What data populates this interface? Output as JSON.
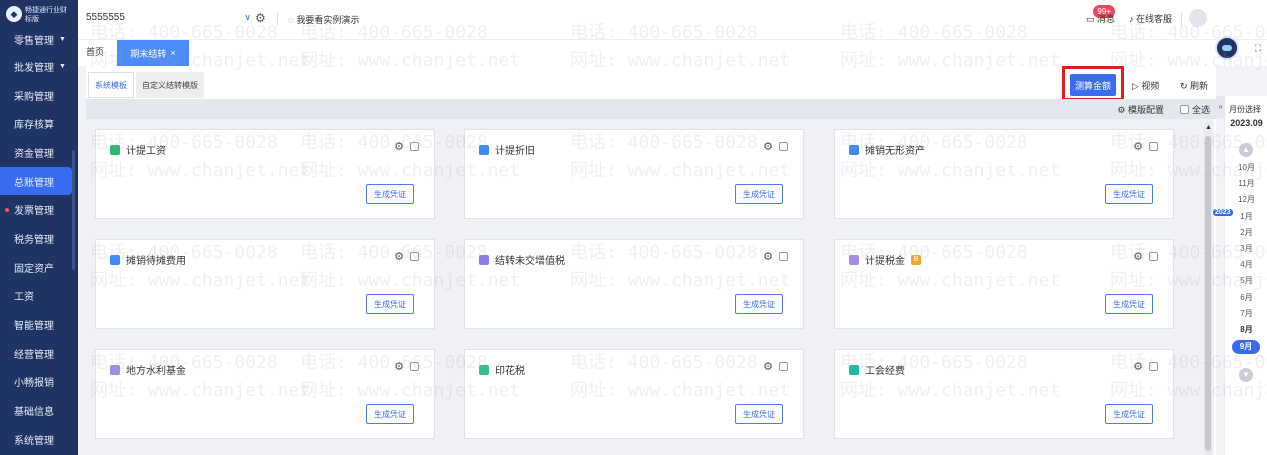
{
  "sidebar": {
    "brand": "畅捷通行业财\n标版",
    "items": [
      {
        "label": "零售管理"
      },
      {
        "label": "批发管理"
      },
      {
        "label": "采购管理"
      },
      {
        "label": "库存核算"
      },
      {
        "label": "资金管理"
      },
      {
        "label": "总账管理"
      },
      {
        "label": "发票管理"
      },
      {
        "label": "税务管理"
      },
      {
        "label": "固定资产"
      },
      {
        "label": "工资"
      },
      {
        "label": "智能管理"
      },
      {
        "label": "经营管理"
      },
      {
        "label": "小畅报销"
      },
      {
        "label": "基础信息"
      },
      {
        "label": "系统管理"
      }
    ]
  },
  "topbar": {
    "account_name": "5555555",
    "demo_label": "我要看实例演示",
    "message_label": "消息",
    "message_badge": "99+",
    "service_label": "在线客服"
  },
  "tabs": {
    "home_label": "首页",
    "current_label": "期末结转",
    "close": "×"
  },
  "panel": {
    "subtabs": [
      "系统模板",
      "自定义结转模版"
    ],
    "calc_button": "测算金额",
    "video_label": "视频",
    "refresh_label": "刷新",
    "template_config": "模版配置",
    "select_all": "全选",
    "generate_label": "生成凭证",
    "cards": [
      {
        "title": "计提工资",
        "icon_color": "#2eb872"
      },
      {
        "title": "计提折旧",
        "icon_color": "#3d8cf5"
      },
      {
        "title": "摊销无形资产",
        "icon_color": "#3d8cf5"
      },
      {
        "title": "摊销待摊费用",
        "icon_color": "#3d8cf5"
      },
      {
        "title": "结转未交增值税",
        "icon_color": "#8c7bea"
      },
      {
        "title": "计提税金",
        "icon_color": "#a98ae8",
        "tag": "B"
      },
      {
        "title": "地方水利基金",
        "icon_color": "#9b8fe6"
      },
      {
        "title": "印花税",
        "icon_color": "#34c18a"
      },
      {
        "title": "工会经费",
        "icon_color": "#1fb8a6"
      }
    ]
  },
  "months": {
    "title": "月份选择",
    "current": "2023.09",
    "year_badge": "2023",
    "items": [
      "10月",
      "11月",
      "12月",
      "1月",
      "2月",
      "3月",
      "4月",
      "5月",
      "6月",
      "7月",
      "8月",
      "9月"
    ],
    "selected": "9月"
  },
  "watermark": {
    "phone": "电话: 400-665-0028",
    "site": "网址: www.chanjet.net"
  }
}
